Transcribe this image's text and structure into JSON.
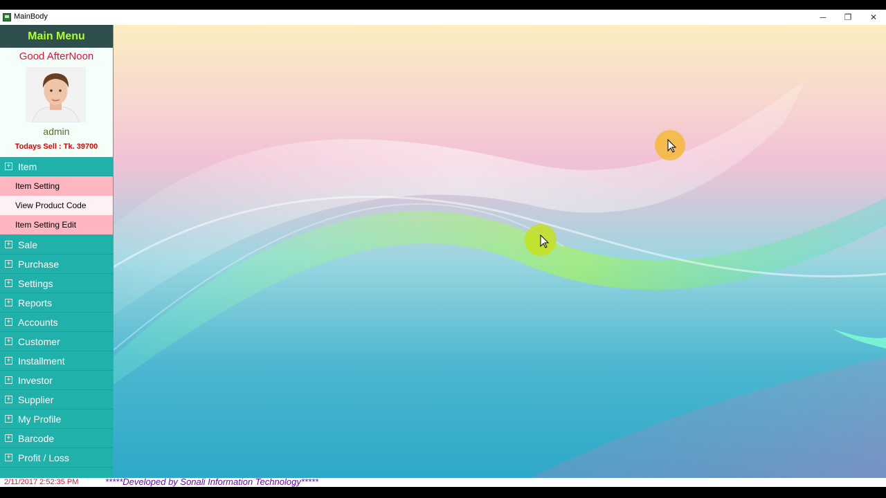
{
  "window": {
    "title": "MainBody",
    "controls": {
      "minimize": "─",
      "maximize": "❐",
      "close": "✕"
    }
  },
  "sidebar": {
    "heading": "Main Menu",
    "greeting": "Good AfterNoon",
    "username": "admin",
    "todays_sell": "Todays Sell : Tk. 39700",
    "menu": [
      {
        "label": "Item",
        "expanded": true,
        "children": [
          "Item Setting",
          "View Product Code",
          "Item Setting Edit"
        ]
      },
      {
        "label": "Sale"
      },
      {
        "label": "Purchase"
      },
      {
        "label": "Settings"
      },
      {
        "label": "Reports"
      },
      {
        "label": "Accounts"
      },
      {
        "label": "Customer"
      },
      {
        "label": "Installment"
      },
      {
        "label": "Investor"
      },
      {
        "label": "Supplier"
      },
      {
        "label": "My Profile"
      },
      {
        "label": "Barcode"
      },
      {
        "label": "Profit / Loss"
      }
    ]
  },
  "statusbar": {
    "datetime": "2/11/2017 2:52:35 PM",
    "developer": "*****Developed by Sonali Information Technology*****"
  },
  "colors": {
    "menu_bg": "#20b2aa",
    "heading_bg": "#2f4f4f",
    "heading_text": "#adff2f",
    "greeting_text": "#dc143c",
    "sub_item_bg": "#ffb6c1"
  }
}
